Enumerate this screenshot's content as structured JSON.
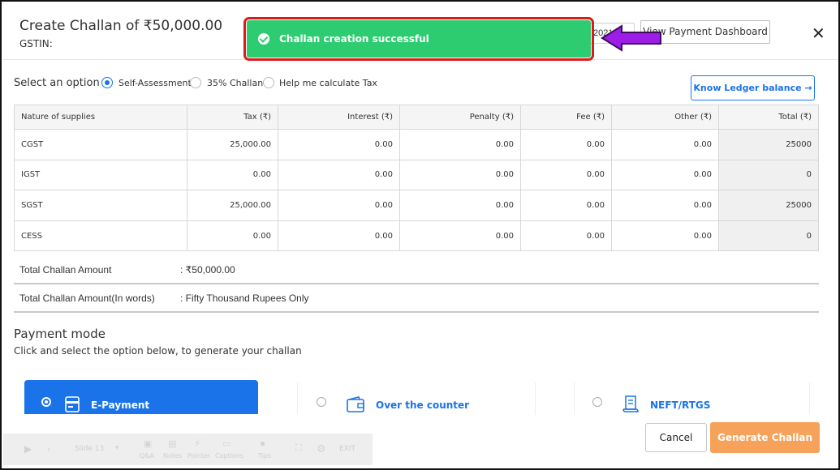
{
  "header": {
    "title": "Create Challan of ₹50,000.00",
    "gstin_label": "GSTIN:",
    "date_fragment": "2021",
    "dashboard_button": "View Payment Dashboard"
  },
  "toast": {
    "message": "Challan creation successful",
    "color": "#2ecc71",
    "highlight_color": "#e0181b"
  },
  "annotation_arrow_color": "#9b1de6",
  "options": {
    "label": "Select an option",
    "items": [
      {
        "label": "Self-Assessment",
        "selected": true
      },
      {
        "label": "35% Challan",
        "selected": false
      },
      {
        "label": "Help me calculate Tax",
        "selected": false
      }
    ],
    "ledger_button": "Know Ledger balance →"
  },
  "table": {
    "headers": [
      "Nature of supplies",
      "Tax (₹)",
      "Interest (₹)",
      "Penalty (₹)",
      "Fee (₹)",
      "Other (₹)",
      "Total (₹)"
    ],
    "rows": [
      [
        "CGST",
        "25,000.00",
        "0.00",
        "0.00",
        "0.00",
        "0.00",
        "25000"
      ],
      [
        "IGST",
        "0.00",
        "0.00",
        "0.00",
        "0.00",
        "0.00",
        "0"
      ],
      [
        "SGST",
        "25,000.00",
        "0.00",
        "0.00",
        "0.00",
        "0.00",
        "25000"
      ],
      [
        "CESS",
        "0.00",
        "0.00",
        "0.00",
        "0.00",
        "0.00",
        "0"
      ]
    ]
  },
  "totals": {
    "amount_label": "Total Challan Amount",
    "amount_value": ": ₹50,000.00",
    "words_label": "Total Challan Amount(In words)",
    "words_value": ": Fifty Thousand Rupees Only"
  },
  "payment": {
    "title": "Payment mode",
    "subtitle": "Click and select the option below, to generate your challan",
    "modes": [
      {
        "label": "E-Payment",
        "selected": true,
        "icon": "card-icon"
      },
      {
        "label": "Over the counter",
        "selected": false,
        "icon": "wallet-icon"
      },
      {
        "label": "NEFT/RTGS",
        "selected": false,
        "icon": "receipt-icon"
      }
    ],
    "accent": "#1a73e8"
  },
  "footer": {
    "cancel": "Cancel",
    "generate": "Generate Challan",
    "generate_color": "#f7a25b"
  },
  "player": {
    "slide": "Slide 13",
    "items": [
      "Q&A",
      "Notes",
      "Pointer",
      "Captions",
      "Tips"
    ],
    "exit": "EXIT"
  }
}
